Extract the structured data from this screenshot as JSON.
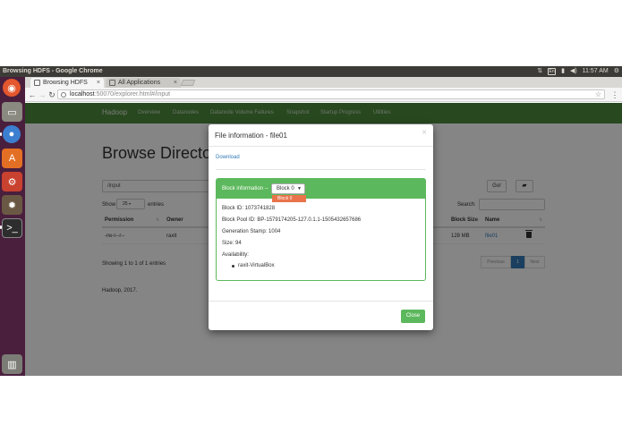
{
  "os": {
    "window_title": "Browsing HDFS - Google Chrome",
    "keyboard_indicator": "En",
    "time": "11:57 AM"
  },
  "browser": {
    "tabs": [
      {
        "label": "Browsing HDFS",
        "active": true
      },
      {
        "label": "All Applications",
        "active": false
      }
    ],
    "url_host": "localhost",
    "url_path": ":50070/explorer.html#/input"
  },
  "page": {
    "brand": "Hadoop",
    "nav": [
      "Overview",
      "Datanodes",
      "Datanode Volume Failures",
      "Snapshot",
      "Startup Progress",
      "Utilities"
    ],
    "heading": "Browse Directory",
    "directory": "/input",
    "go_label": "Go!",
    "show_label": "Show",
    "show_value": "25",
    "entries_label": "entries",
    "search_label": "Search:",
    "columns": {
      "permission": "Permission",
      "owner": "Owner",
      "block_size": "Block Size",
      "name": "Name"
    },
    "row": {
      "permission": "-rw-r--r--",
      "owner": "raxit",
      "block_size": "128 MB",
      "name": "file01"
    },
    "showing": "Showing 1 to 1 of 1 entries",
    "pagination": {
      "previous": "Previous",
      "current": "1",
      "next": "Next"
    },
    "footer": "Hadoop, 2017."
  },
  "modal": {
    "title": "File information - file01",
    "close_symbol": "×",
    "download": "Download",
    "panel_label": "Block information --",
    "block_selected": "Block 0",
    "block_options": [
      "Block 0"
    ],
    "block_id": "Block ID: 1073741828",
    "block_pool_id": "Block Pool ID: BP-1579174205-127.0.1.1-1505432657686",
    "generation_stamp": "Generation Stamp: 1004",
    "size": "Size: 94",
    "availability_label": "Availability:",
    "availability": [
      "raxit-VirtualBox"
    ],
    "close_button": "Close"
  },
  "colors": {
    "navbar": "#4d8b3c",
    "success": "#5cb85c",
    "link": "#337ab7",
    "dropdown_highlight": "#e9734b",
    "launcher": "#4a1f3d"
  }
}
